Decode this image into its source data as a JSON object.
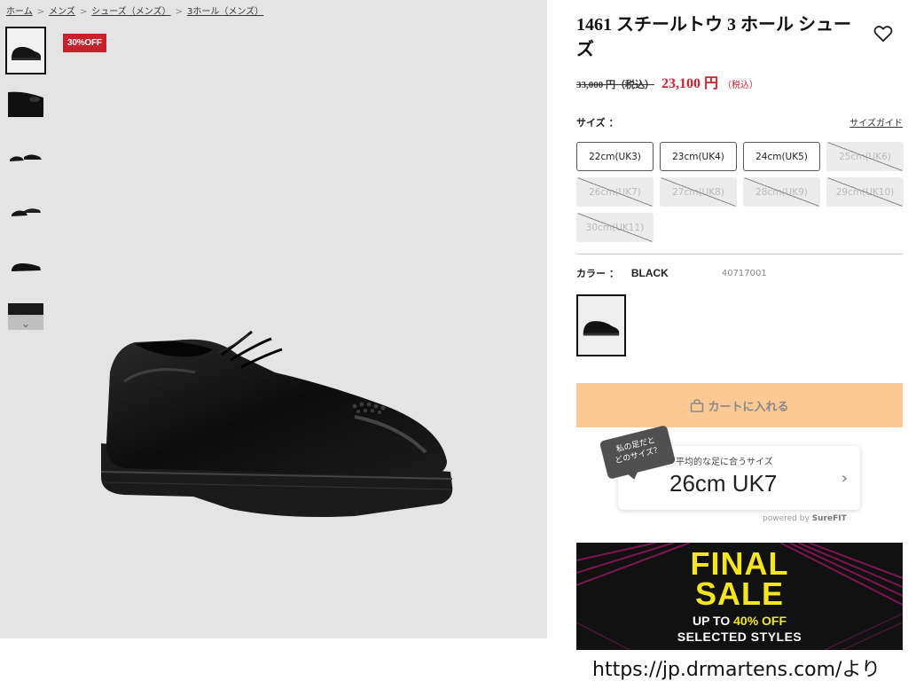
{
  "breadcrumb": [
    {
      "label": "ホーム"
    },
    {
      "label": "メンズ"
    },
    {
      "label": "シューズ（メンズ）"
    },
    {
      "label": "3ホール（メンズ）"
    }
  ],
  "breadcrumb_sep": ">",
  "badge": "30%OFF",
  "product": {
    "title": "1461 スチールトウ 3 ホール シューズ",
    "price_old": "33,000 円（税込）",
    "price_new": "23,100 円",
    "price_tax": "（税込）"
  },
  "size_section": {
    "label": "サイズ ：",
    "guide_link": "サイズガイド",
    "sizes": [
      {
        "label": "22cm(UK3)",
        "available": true
      },
      {
        "label": "23cm(UK4)",
        "available": true
      },
      {
        "label": "24cm(UK5)",
        "available": true
      },
      {
        "label": "25cm(UK6)",
        "available": false
      },
      {
        "label": "26cm(UK7)",
        "available": false
      },
      {
        "label": "27cm(UK8)",
        "available": false
      },
      {
        "label": "28cm(UK9)",
        "available": false
      },
      {
        "label": "29cm(UK10)",
        "available": false
      },
      {
        "label": "30cm(UK11)",
        "available": false
      }
    ]
  },
  "color_section": {
    "label": "カラー ：",
    "value": "BLACK",
    "sku": "40717001"
  },
  "cart_button": "カートに入れる",
  "surefit": {
    "bubble": "私の足だと\nどのサイズ？",
    "subtitle": "平均的な足に合うサイズ",
    "value": "26cm UK7",
    "powered_prefix": "powered by ",
    "powered_brand": "SureFIT"
  },
  "sale_banner": {
    "line1": "FINAL",
    "line2": "SALE",
    "line3_prefix": "UP TO ",
    "line3_highlight": "40% OFF",
    "line4": "SELECTED STYLES"
  },
  "caption": "https://jp.drmartens.com/より",
  "colors": {
    "badge": "#c8202d",
    "price": "#d81e2b",
    "cart_button": "#fcc893",
    "sale_yellow": "#f5e51c"
  }
}
